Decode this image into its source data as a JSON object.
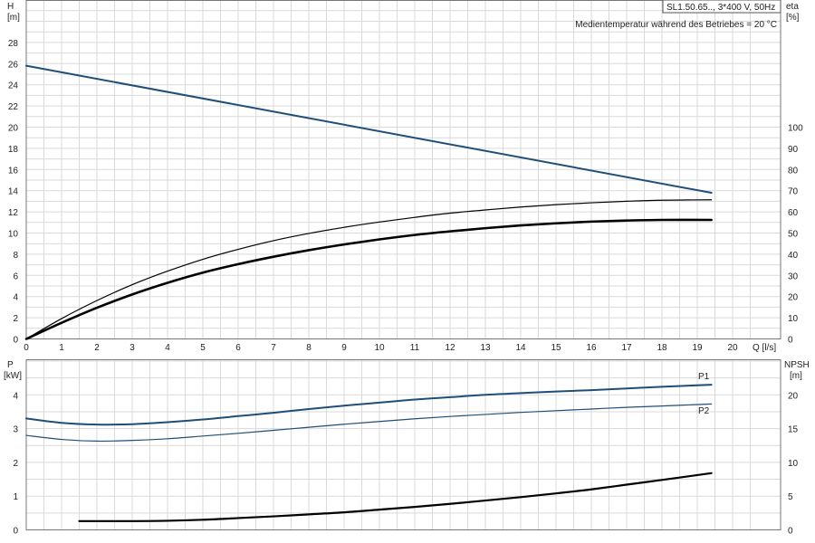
{
  "chart_data": [
    {
      "type": "line",
      "panel": "top",
      "title_box": "SL1.50.65.., 3*400 V, 50Hz",
      "subtitle": "Medientemperatur während des Betriebes = 20 °C",
      "ylabel_left": "H",
      "ylabel_left_unit": "[m]",
      "ylabel_right": "eta",
      "ylabel_right_unit": "[%]",
      "xlabel": "Q [l/s]",
      "xlim": [
        0,
        21
      ],
      "ylim": [
        0,
        30
      ],
      "ylim_right": [
        0,
        130
      ],
      "grid": true,
      "x_ticks": [
        "0",
        "1",
        "2",
        "3",
        "4",
        "5",
        "6",
        "7",
        "8",
        "9",
        "10",
        "11",
        "12",
        "13",
        "14",
        "15",
        "16",
        "17",
        "18",
        "19",
        "20"
      ],
      "y_ticks_left": [
        "0",
        "2",
        "4",
        "6",
        "8",
        "10",
        "12",
        "14",
        "16",
        "18",
        "20",
        "22",
        "24",
        "26",
        "28"
      ],
      "y_ticks_right": [
        "0",
        "10",
        "20",
        "30",
        "40",
        "50",
        "60",
        "70",
        "80",
        "90",
        "100"
      ],
      "series": [
        {
          "role": "head",
          "axis": "left",
          "color": "#1f4e79",
          "x": [
            0,
            19.4
          ],
          "y": [
            25.8,
            13.8
          ]
        },
        {
          "role": "efficiency-thin",
          "axis": "right",
          "color": "#000000",
          "x": [
            0,
            1,
            2,
            3,
            4,
            5,
            6,
            7,
            8,
            9,
            10,
            11,
            12,
            13,
            14,
            15,
            16,
            17,
            18,
            19.4
          ],
          "y": [
            0,
            9.6,
            18.1,
            25.6,
            32.0,
            37.6,
            42.3,
            46.4,
            49.8,
            52.7,
            55.2,
            57.4,
            59.4,
            60.9,
            62.3,
            63.4,
            64.3,
            65.0,
            65.5,
            65.7
          ]
        },
        {
          "role": "efficiency-thick",
          "axis": "right",
          "color": "#000000",
          "x": [
            0,
            1,
            2,
            3,
            4,
            5,
            6,
            7,
            8,
            9,
            10,
            11,
            12,
            13,
            14,
            15,
            16,
            17,
            18,
            19.4
          ],
          "y": [
            0,
            7.6,
            14.7,
            21.0,
            26.5,
            31.3,
            35.3,
            38.8,
            41.9,
            44.6,
            47.0,
            49.1,
            50.8,
            52.3,
            53.6,
            54.6,
            55.4,
            55.9,
            56.2,
            56.2
          ]
        }
      ]
    },
    {
      "type": "line",
      "panel": "bottom",
      "ylabel_left": "P",
      "ylabel_left_unit": "[kW]",
      "ylabel_right": "NPSH",
      "ylabel_right_unit": "[m]",
      "xlim": [
        0,
        21
      ],
      "ylim": [
        0,
        5
      ],
      "ylim_right": [
        0,
        25
      ],
      "grid": true,
      "y_ticks_left": [
        "0",
        "1",
        "2",
        "3",
        "4"
      ],
      "y_ticks_right": [
        "0",
        "5",
        "10",
        "15",
        "20"
      ],
      "series": [
        {
          "name": "P1",
          "axis": "left",
          "color": "#1f4e79",
          "x": [
            0,
            1,
            2,
            3,
            4,
            5,
            6,
            7,
            8,
            9,
            10,
            11,
            12,
            13,
            14,
            15,
            16,
            17,
            18,
            19.4
          ],
          "y": [
            3.3,
            3.17,
            3.12,
            3.13,
            3.19,
            3.27,
            3.37,
            3.47,
            3.58,
            3.68,
            3.77,
            3.86,
            3.93,
            4.0,
            4.05,
            4.1,
            4.14,
            4.19,
            4.24,
            4.3
          ]
        },
        {
          "name": "P2",
          "axis": "left",
          "color": "#1f4e79",
          "x": [
            0,
            1,
            2,
            3,
            4,
            5,
            6,
            7,
            8,
            9,
            10,
            11,
            12,
            13,
            14,
            15,
            16,
            17,
            18,
            19.4
          ],
          "y": [
            2.8,
            2.68,
            2.63,
            2.65,
            2.7,
            2.78,
            2.86,
            2.95,
            3.04,
            3.13,
            3.21,
            3.29,
            3.36,
            3.42,
            3.48,
            3.53,
            3.58,
            3.63,
            3.67,
            3.73
          ]
        },
        {
          "role": "npsh",
          "axis": "right",
          "color": "#000000",
          "x": [
            1.5,
            2,
            3,
            4,
            5,
            6,
            7,
            8,
            9,
            10,
            11,
            12,
            13,
            14,
            15,
            16,
            17,
            18,
            19.4
          ],
          "y": [
            1.3,
            1.3,
            1.3,
            1.35,
            1.5,
            1.75,
            2.0,
            2.3,
            2.6,
            3.0,
            3.4,
            3.85,
            4.35,
            4.85,
            5.4,
            6.0,
            6.7,
            7.4,
            8.4
          ]
        }
      ]
    }
  ]
}
